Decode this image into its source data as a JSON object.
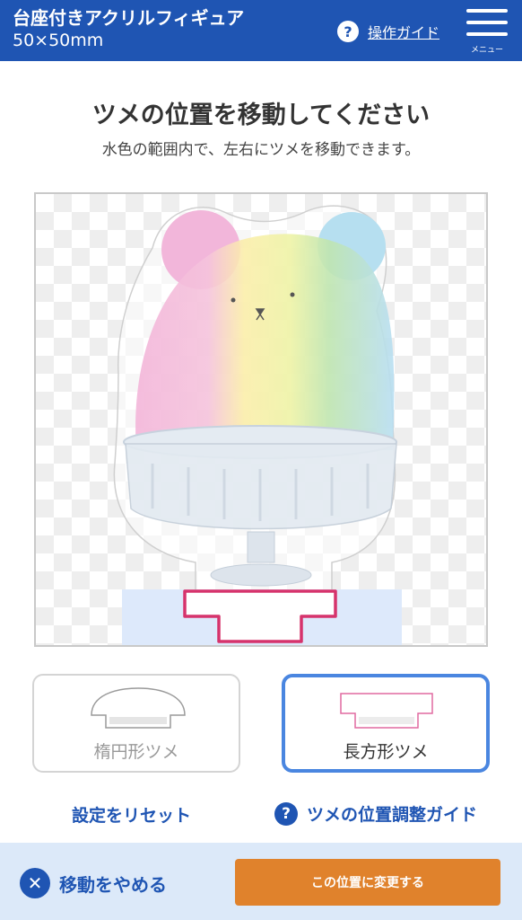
{
  "header": {
    "title": "台座付きアクリルフィギュア",
    "subtitle": "50×50mm",
    "guide_icon": "?",
    "guide_label": "操作ガイド",
    "menu_label": "メニュー",
    "background_color": "#1f55b3"
  },
  "main": {
    "heading": "ツメの位置を移動してください",
    "subheading": "水色の範囲内で、左右にツメを移動できます。"
  },
  "tab_choices": [
    {
      "label": "楕円形ツメ",
      "selected": false,
      "icon": "ellipse-tab-icon"
    },
    {
      "label": "長方形ツメ",
      "selected": true,
      "icon": "rectangle-tab-icon"
    }
  ],
  "links": {
    "reset": "設定をリセット",
    "position_guide_icon": "?",
    "position_guide": "ツメの位置調整ガイド"
  },
  "footer": {
    "cancel_icon": "✕",
    "cancel": "移動をやめる",
    "apply": "この位置に変更する",
    "apply_color": "#e0822c"
  }
}
